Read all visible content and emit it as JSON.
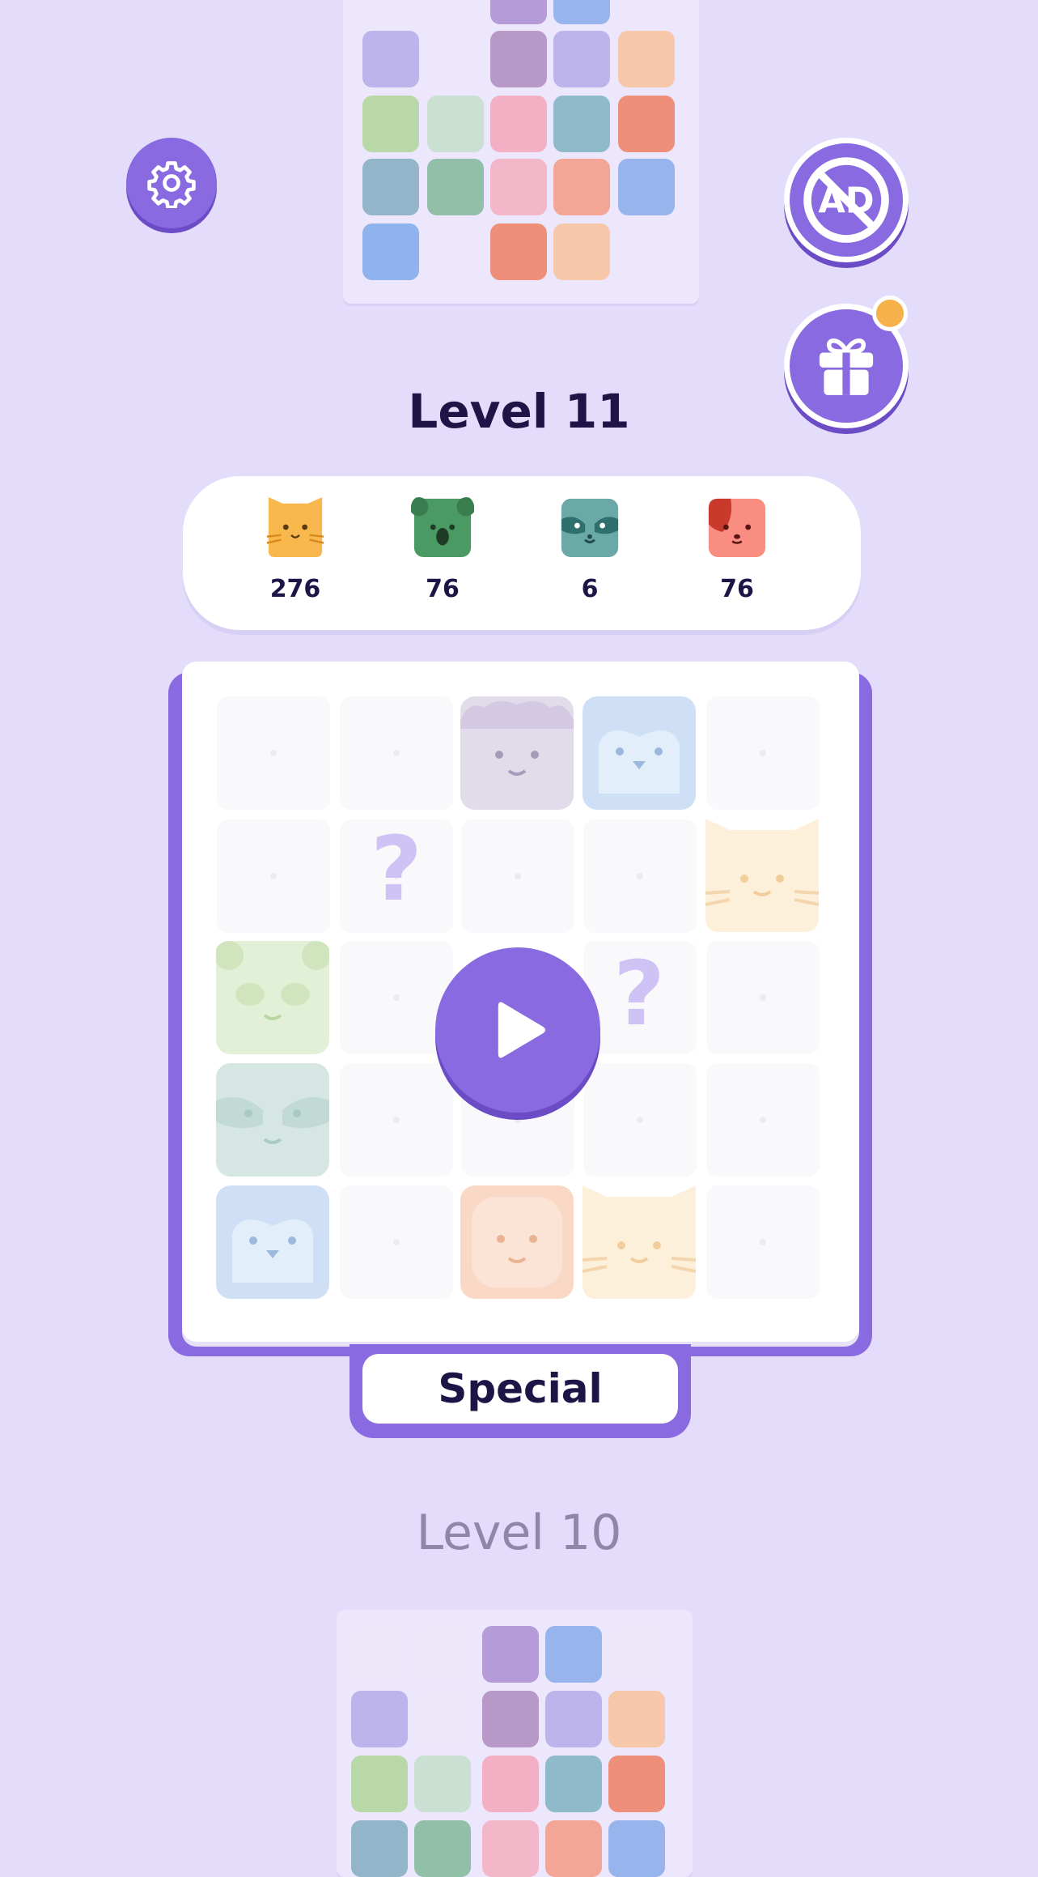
{
  "current_level": {
    "title": "Level 11",
    "mode_label": "Special",
    "goals": [
      {
        "animal": "cat-icon",
        "color": "#f9b84e",
        "count": "276"
      },
      {
        "animal": "koala-icon",
        "color": "#4b9a63",
        "count": "76"
      },
      {
        "animal": "raccoon-icon",
        "color": "#3d9590",
        "count": "6"
      },
      {
        "animal": "dog-icon",
        "color": "#f4766b",
        "count": "76"
      }
    ],
    "hidden_marks": [
      "?",
      "?"
    ]
  },
  "previous_level": {
    "title": "Level 10"
  },
  "buttons": {
    "settings": "gear-icon",
    "no_ads": "no-ads-icon",
    "gift": "gift-icon",
    "play": "play-icon"
  },
  "colors": {
    "background": "#e4dcfb",
    "accent": "#8a6ae0",
    "accent_dark": "#6b4cc6",
    "notification": "#f6b14a"
  }
}
